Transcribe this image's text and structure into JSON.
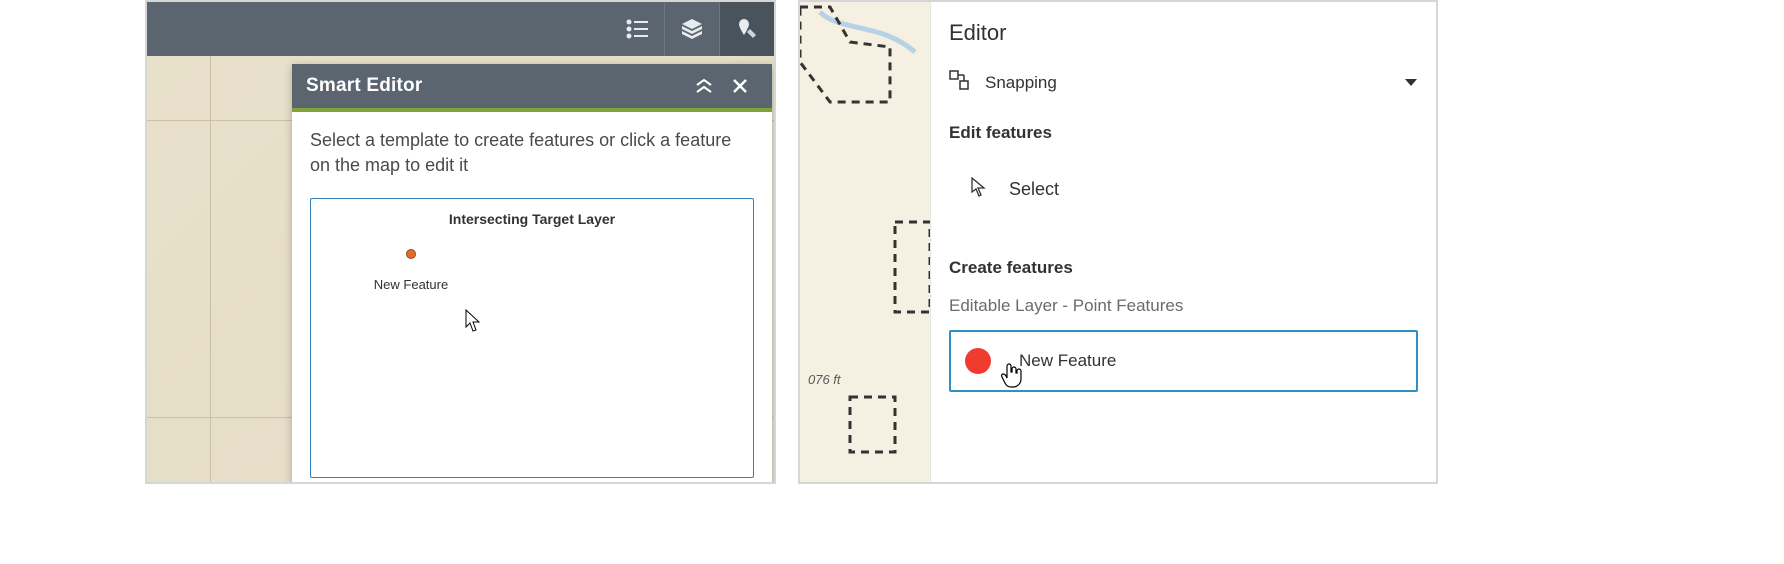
{
  "left": {
    "header_title": "Smart Editor",
    "instruction": "Select a template to create features or click a feature on the map to edit it",
    "layer_title": "Intersecting Target Layer",
    "template_label": "New Feature"
  },
  "right": {
    "title": "Editor",
    "snapping_label": "Snapping",
    "edit_section": "Edit features",
    "select_label": "Select",
    "create_section": "Create features",
    "layer_label": "Editable Layer - Point Features",
    "feature_label": "New Feature",
    "scale_text": "076 ft"
  }
}
